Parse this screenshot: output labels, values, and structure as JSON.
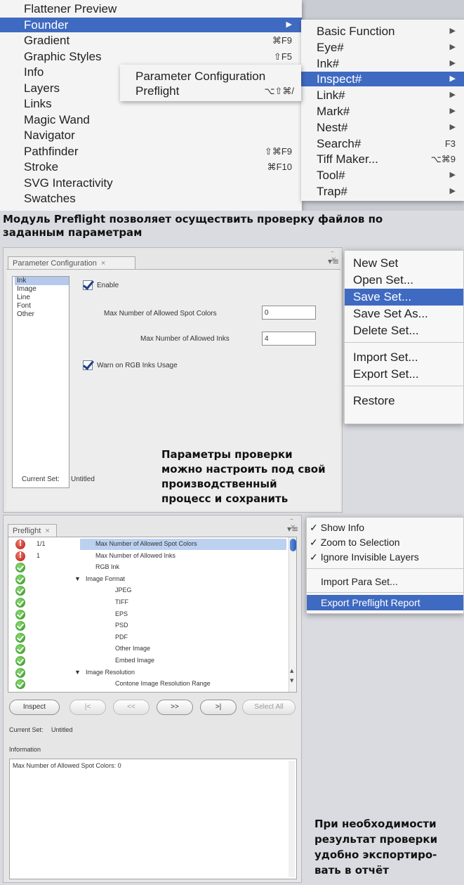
{
  "view_menu": {
    "items": [
      {
        "label": "Flattener Preview",
        "shortcut": "",
        "submenu": false
      },
      {
        "label": "Founder",
        "shortcut": "",
        "submenu": true,
        "selected": true
      },
      {
        "label": "Gradient",
        "shortcut": "⌘F9",
        "submenu": false
      },
      {
        "label": "Graphic Styles",
        "shortcut": "⇧F5",
        "submenu": false
      },
      {
        "label": "Info",
        "shortcut": "",
        "submenu": false
      },
      {
        "label": "Layers",
        "shortcut": "",
        "submenu": false
      },
      {
        "label": "Links",
        "shortcut": "",
        "submenu": false
      },
      {
        "label": "Magic Wand",
        "shortcut": "",
        "submenu": false
      },
      {
        "label": "Navigator",
        "shortcut": "",
        "submenu": false
      },
      {
        "label": "Pathfinder",
        "shortcut": "⇧⌘F9",
        "submenu": false
      },
      {
        "label": "Stroke",
        "shortcut": "⌘F10",
        "submenu": false
      },
      {
        "label": "SVG Interactivity",
        "shortcut": "",
        "submenu": false
      },
      {
        "label": "Swatches",
        "shortcut": "",
        "submenu": false
      }
    ]
  },
  "inspect_submenu": {
    "items": [
      {
        "label": "Parameter Configuration",
        "shortcut": ""
      },
      {
        "label": "Preflight",
        "shortcut": "⌥⇧⌘/"
      }
    ]
  },
  "founder_submenu": {
    "items": [
      {
        "label": "Basic Function",
        "shortcut": "",
        "submenu": true
      },
      {
        "label": "Eye#",
        "shortcut": "",
        "submenu": true
      },
      {
        "label": "Ink#",
        "shortcut": "",
        "submenu": true
      },
      {
        "label": "Inspect#",
        "shortcut": "",
        "submenu": true,
        "selected": true
      },
      {
        "label": "Link#",
        "shortcut": "",
        "submenu": true
      },
      {
        "label": "Mark#",
        "shortcut": "",
        "submenu": true
      },
      {
        "label": "Nest#",
        "shortcut": "",
        "submenu": true
      },
      {
        "label": "Search#",
        "shortcut": "F3",
        "submenu": false
      },
      {
        "label": "Tiff Maker...",
        "shortcut": "⌥⌘9",
        "submenu": false
      },
      {
        "label": "Tool#",
        "shortcut": "",
        "submenu": true
      },
      {
        "label": "Trap#",
        "shortcut": "",
        "submenu": true
      }
    ]
  },
  "captions": {
    "one": "Модуль Preflight позволяет осуществить проверку файлов по заданным параметрам",
    "two": "Параметры проверки можно настроить под свой производственный процесс и сохранить",
    "three": "При необходимости результат проверки удобно экспортиро-вать в отчёт"
  },
  "param_panel": {
    "tab_label": "Parameter Configuration",
    "close_glyph": "×",
    "categories": [
      "Ink",
      "Image",
      "Line",
      "Font",
      "Other"
    ],
    "enable_label": "Enable",
    "spot_label": "Max Number of Allowed Spot Colors",
    "spot_value": "0",
    "inks_label": "Max Number of Allowed Inks",
    "inks_value": "4",
    "rgb_label": "Warn on RGB Inks Usage",
    "current_set_label": "Current Set:",
    "current_set_value": "Untitled"
  },
  "set_menu": {
    "items": [
      "New Set",
      "Open Set...",
      "Save Set...",
      "Save Set As...",
      "Delete Set...",
      "Import Set...",
      "Export Set...",
      "Restore"
    ]
  },
  "preflight_panel": {
    "tab_label": "Preflight",
    "close_glyph": "×",
    "rows": [
      {
        "status": "error",
        "count": "1/1",
        "label": "Max Number of Allowed Spot Colors",
        "indent": 0,
        "selected": true
      },
      {
        "status": "error",
        "count": "1",
        "label": "Max Number of Allowed Inks",
        "indent": 0
      },
      {
        "status": "ok",
        "count": "",
        "label": "RGB Ink",
        "indent": 0
      },
      {
        "status": "ok",
        "count": "",
        "label": "Image Format",
        "indent": 0,
        "expanded": true
      },
      {
        "status": "ok",
        "count": "",
        "label": "JPEG",
        "indent": 1
      },
      {
        "status": "ok",
        "count": "",
        "label": "TIFF",
        "indent": 1
      },
      {
        "status": "ok",
        "count": "",
        "label": "EPS",
        "indent": 1
      },
      {
        "status": "ok",
        "count": "",
        "label": "PSD",
        "indent": 1
      },
      {
        "status": "ok",
        "count": "",
        "label": "PDF",
        "indent": 1
      },
      {
        "status": "ok",
        "count": "",
        "label": "Other Image",
        "indent": 1
      },
      {
        "status": "ok",
        "count": "",
        "label": "Embed Image",
        "indent": 1
      },
      {
        "status": "ok",
        "count": "",
        "label": "Image Resolution",
        "indent": 0,
        "expanded": true
      },
      {
        "status": "ok",
        "count": "",
        "label": "Contone Image Resolution Range",
        "indent": 1
      }
    ],
    "buttons": {
      "inspect": "Inspect",
      "first": "|<",
      "prev": "<<",
      "next": ">>",
      "last": ">|",
      "select_all": "Select All"
    },
    "current_set_label": "Current Set:",
    "current_set_value": "Untitled",
    "information_label": "Information",
    "information_text": "Max Number of Allowed Spot Colors: 0"
  },
  "preflight_menu": {
    "checked_items": [
      "Show Info",
      "Zoom to Selection",
      "Ignore Invisible Layers"
    ],
    "check_glyph": "✓",
    "import_label": "Import Para Set...",
    "export_label": "Export Preflight Report"
  },
  "colors": {
    "selection": "#3f6ac1",
    "error": "#c0261a",
    "ok": "#35a024"
  }
}
